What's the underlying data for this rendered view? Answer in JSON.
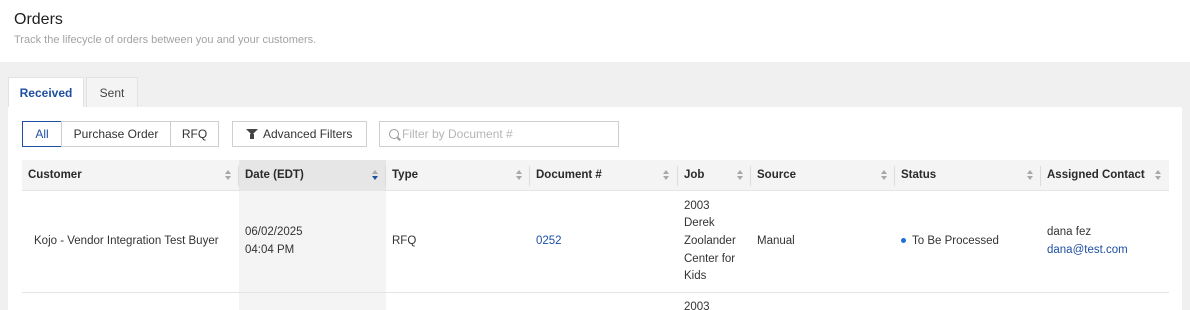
{
  "page": {
    "title": "Orders",
    "subtitle": "Track the lifecycle of orders between you and your customers."
  },
  "tabs": [
    {
      "label": "Received",
      "active": true
    },
    {
      "label": "Sent",
      "active": false
    }
  ],
  "segment_filter": {
    "options": [
      "All",
      "Purchase Order",
      "RFQ"
    ],
    "selected": "All"
  },
  "advanced_filters_label": "Advanced Filters",
  "search": {
    "placeholder": "Filter by Document #",
    "value": ""
  },
  "table": {
    "columns": [
      "Customer",
      "Date (EDT)",
      "Type",
      "Document #",
      "Job",
      "Source",
      "Status",
      "Assigned Contact"
    ],
    "sorted_column": "Date (EDT)",
    "sort_direction": "descending",
    "rows": [
      {
        "customer": "Kojo - Vendor Integration Test Buyer",
        "date": "06/02/2025",
        "time": "04:04 PM",
        "type": "RFQ",
        "document": "0252",
        "job_lines": [
          "2003",
          "Derek",
          "Zoolander",
          "Center for",
          "Kids"
        ],
        "source": "Manual",
        "status": "To Be Processed",
        "contact_name": "dana fez",
        "contact_email": "dana@test.com"
      },
      {
        "job_lines": [
          "2003"
        ]
      }
    ]
  },
  "colors": {
    "accent": "#1f4fa0",
    "status_dot": "#1f6fd6",
    "page_bg": "#f0f0f0"
  }
}
